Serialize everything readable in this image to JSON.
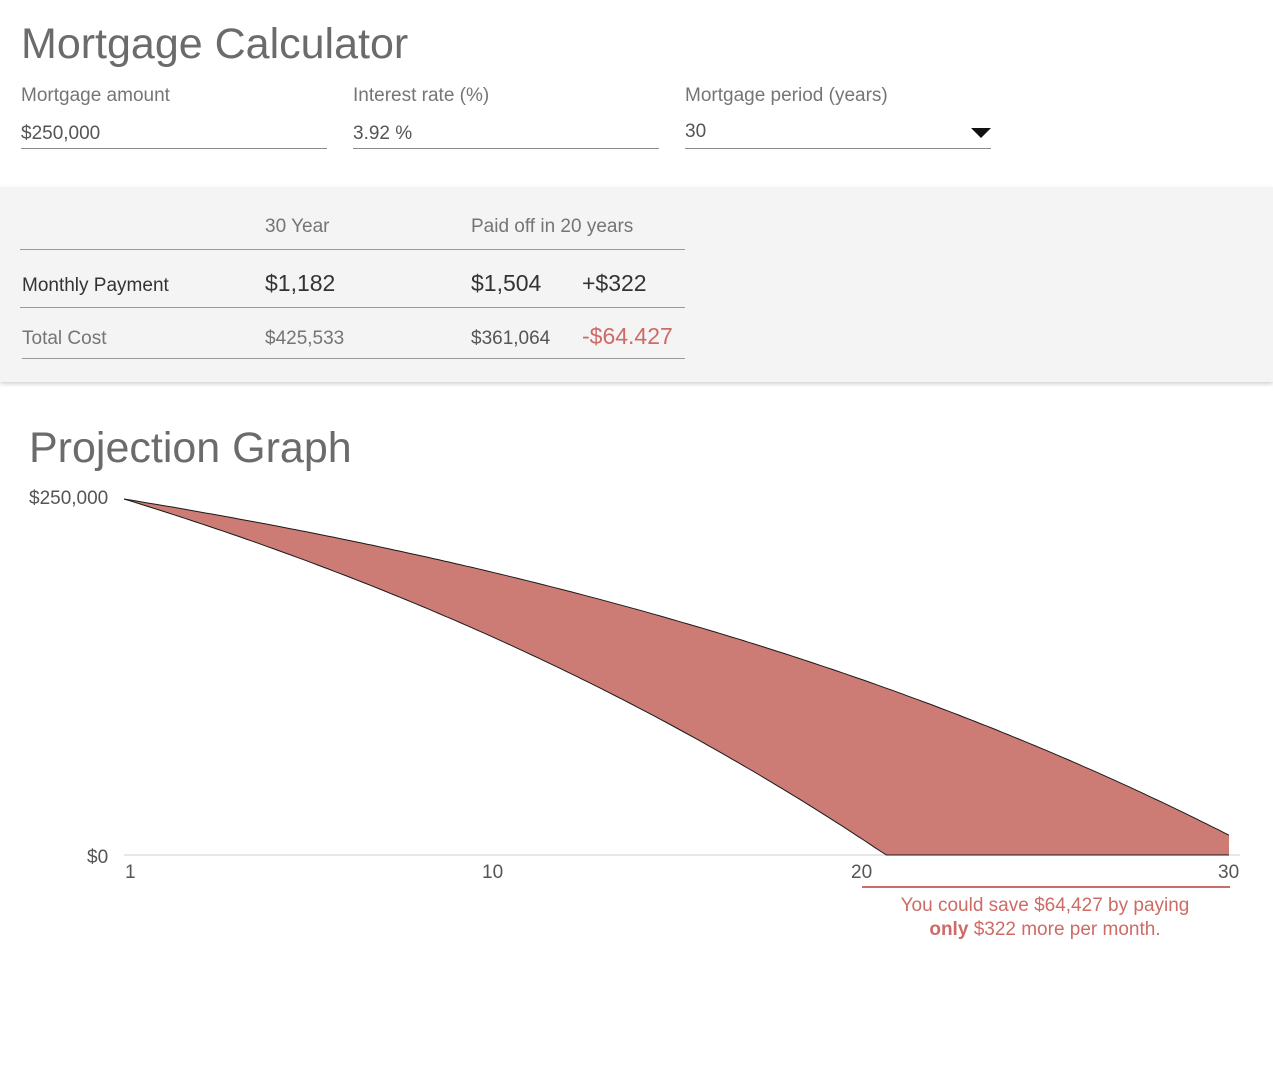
{
  "title": "Mortgage Calculator",
  "inputs": {
    "amount": {
      "label": "Mortgage amount",
      "value": "$250,000"
    },
    "rate": {
      "label": "Interest rate (%)",
      "value": "3.92 %"
    },
    "period": {
      "label": "Mortgage period (years)",
      "value": "30"
    }
  },
  "summary": {
    "col_headers": [
      "30 Year",
      "Paid off in 20 years"
    ],
    "monthly": {
      "label": "Monthly Payment",
      "base": "$1,182",
      "alt": "$1,504",
      "diff": "+$322"
    },
    "total": {
      "label": "Total Cost",
      "base": "$425,533",
      "alt": "$361,064",
      "diff": "-$64.427"
    }
  },
  "graph": {
    "title": "Projection Graph",
    "y_labels": [
      "$250,000",
      "$0"
    ],
    "x_labels": [
      "1",
      "10",
      "20",
      "30"
    ],
    "savings_line1": "You could save $64,427 by paying",
    "savings_bold": "only",
    "savings_rest": "$322 more per month."
  },
  "colors": {
    "accent": "#cd6b66",
    "fill": "#cc7b75"
  },
  "chart_data": {
    "type": "area",
    "x_range": [
      1,
      30
    ],
    "y_range": [
      0,
      250000
    ],
    "principal": 250000,
    "annual_rate_percent": 3.92,
    "series": [
      {
        "name": "30 Year",
        "term_years": 30
      },
      {
        "name": "Paid off in 20 years",
        "term_years": 20
      }
    ]
  }
}
